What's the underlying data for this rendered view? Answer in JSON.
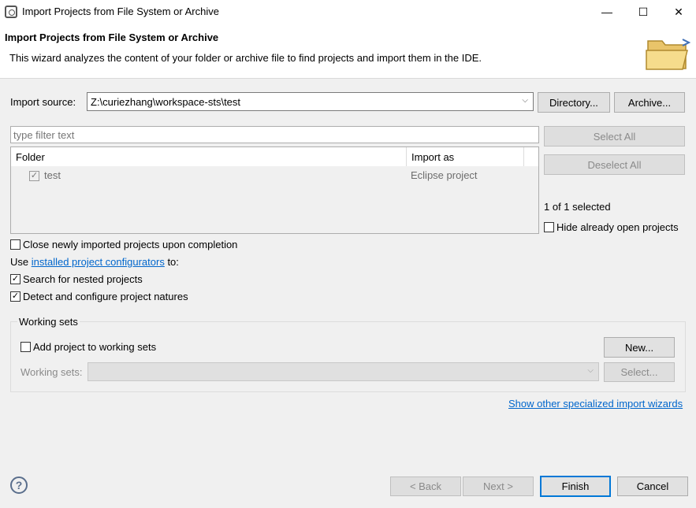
{
  "window": {
    "title": "Import Projects from File System or Archive",
    "minimize_glyph": "—",
    "maximize_glyph": "☐",
    "close_glyph": "✕"
  },
  "header": {
    "title": "Import Projects from File System or Archive",
    "description": "This wizard analyzes the content of your folder or archive file to find projects and import them in the IDE."
  },
  "import_source": {
    "label": "Import source:",
    "value": "Z:\\curiezhang\\workspace-sts\\test",
    "directory_button": "Directory...",
    "archive_button": "Archive..."
  },
  "filter": {
    "placeholder": "type filter text"
  },
  "table": {
    "columns": [
      "Folder",
      "Import as"
    ],
    "rows": [
      {
        "folder": "test",
        "import_as": "Eclipse project",
        "checked": true
      }
    ]
  },
  "side": {
    "select_all": "Select All",
    "deselect_all": "Deselect All",
    "selected_count": "1 of 1 selected",
    "hide_open": "Hide already open projects"
  },
  "options": {
    "close_newly": "Close newly imported projects upon completion",
    "use_prefix": "Use ",
    "configurators_link": "installed project configurators",
    "use_suffix": " to:",
    "search_nested": "Search for nested projects",
    "detect_natures": "Detect and configure project natures"
  },
  "working_sets": {
    "group_label": "Working sets",
    "add_label": "Add project to working sets",
    "new_button": "New...",
    "sets_label": "Working sets:",
    "select_button": "Select..."
  },
  "link_other": "Show other specialized import wizards",
  "footer": {
    "help": "?",
    "back": "< Back",
    "next": "Next >",
    "finish": "Finish",
    "cancel": "Cancel"
  },
  "colors": {
    "accent": "#0078d7",
    "link": "#0066cc"
  },
  "icons": {
    "app": "eclipse-icon",
    "header": "folder-open-icon",
    "help": "help-icon"
  }
}
